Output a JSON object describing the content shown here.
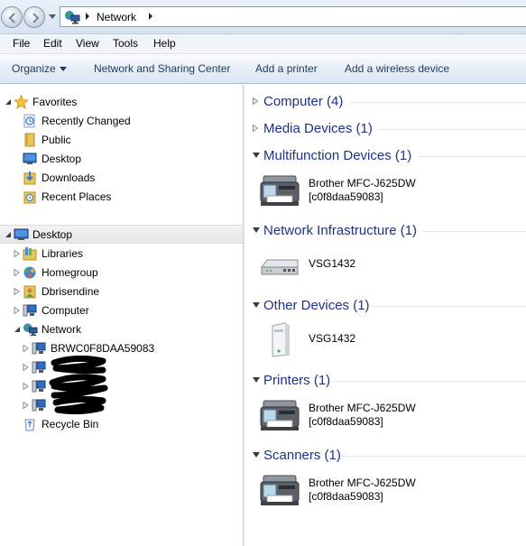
{
  "address_bar": {
    "crumb": "Network"
  },
  "menu": [
    "File",
    "Edit",
    "View",
    "Tools",
    "Help"
  ],
  "command_bar": {
    "organize": "Organize",
    "network_sharing": "Network and Sharing Center",
    "add_printer": "Add a printer",
    "add_wireless": "Add a wireless device"
  },
  "nav": {
    "favorites": {
      "label": "Favorites",
      "items": [
        "Recently Changed",
        "Public",
        "Desktop",
        "Downloads",
        "Recent Places"
      ]
    },
    "desktop": {
      "label": "Desktop",
      "items": [
        "Libraries",
        "Homegroup",
        "Dbrisendine",
        "Computer",
        "Network"
      ]
    },
    "network_children": [
      "BRWC0F8DAA59083"
    ],
    "recycle_bin": "Recycle Bin"
  },
  "groups": {
    "computer": "Computer (4)",
    "media": "Media Devices (1)",
    "multifunction": "Multifunction Devices (1)",
    "netinfra": "Network Infrastructure (1)",
    "other": "Other Devices (1)",
    "printers": "Printers (1)",
    "scanners": "Scanners (1)"
  },
  "devices": {
    "mfd": {
      "name": "Brother MFC-J625DW",
      "sub": "[c0f8daa59083]"
    },
    "router": {
      "name": "VSG1432"
    },
    "other": {
      "name": "VSG1432"
    },
    "printer": {
      "name": "Brother MFC-J625DW",
      "sub": "[c0f8daa59083]"
    },
    "scanner": {
      "name": "Brother MFC-J625DW",
      "sub": "[c0f8daa59083]"
    }
  },
  "colors": {
    "group_header": "#1e3287",
    "command_text": "#1e395b"
  }
}
